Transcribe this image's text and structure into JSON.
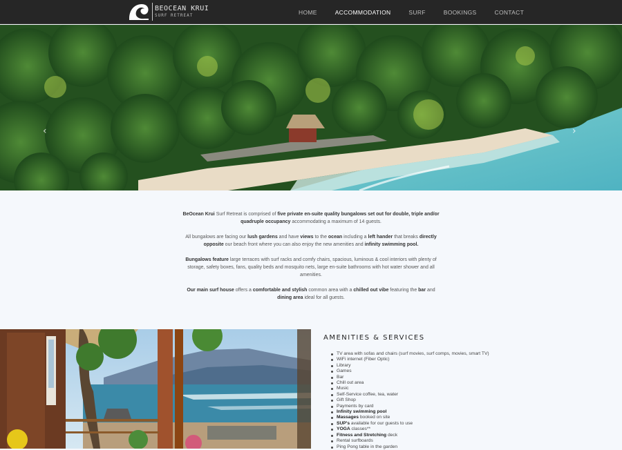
{
  "brand": {
    "name": "BEOCEAN KRUI",
    "tagline": "SURF RETREAT",
    "logo_icon": "wave-icon"
  },
  "nav": {
    "items": [
      {
        "label": "HOME",
        "active": false
      },
      {
        "label": "ACCOMMODATION",
        "active": true
      },
      {
        "label": "SURF",
        "active": false
      },
      {
        "label": "BOOKINGS",
        "active": false
      },
      {
        "label": "CONTACT",
        "active": false
      }
    ]
  },
  "carousel": {
    "prev_icon": "chevron-left-icon",
    "next_icon": "chevron-right-icon",
    "slide_count": 10,
    "active_index": 0,
    "prev_glyph": "‹",
    "next_glyph": "›"
  },
  "intro": {
    "paragraphs": [
      [
        {
          "t": "BeOcean Krui",
          "b": true
        },
        {
          "t": " Surf Retreat is comprised of ",
          "b": false
        },
        {
          "t": "five private en-suite quality bungalows set out for double, triple and/or quadruple occupancy",
          "b": true
        },
        {
          "t": " accommodating a maximum of 14 guests.",
          "b": false
        }
      ],
      [
        {
          "t": "All bungalows are facing our ",
          "b": false
        },
        {
          "t": "lush gardens",
          "b": true
        },
        {
          "t": " and have ",
          "b": false
        },
        {
          "t": "views",
          "b": true
        },
        {
          "t": " to the ",
          "b": false
        },
        {
          "t": "ocean",
          "b": true
        },
        {
          "t": " including a ",
          "b": false
        },
        {
          "t": "left hander",
          "b": true
        },
        {
          "t": " that breaks ",
          "b": false
        },
        {
          "t": "directly opposite",
          "b": true
        },
        {
          "t": " our beach front where you can also enjoy the new amenities and ",
          "b": false
        },
        {
          "t": "infinity swimming pool.",
          "b": true
        }
      ],
      [
        {
          "t": "Bungalows feature",
          "b": true
        },
        {
          "t": " large terraces with surf racks and comfy chairs, spacious, luminous & cool interiors with plenty of storage, safety boxes, fans, quality beds and mosquito nets, large en-suite bathrooms with hot water shower and all amenities.",
          "b": false
        }
      ],
      [
        {
          "t": "Our main surf house",
          "b": true
        },
        {
          "t": " offers a ",
          "b": false
        },
        {
          "t": "comfortable and stylish",
          "b": true
        },
        {
          "t": " common area with a ",
          "b": false
        },
        {
          "t": "chilled out vibe",
          "b": true
        },
        {
          "t": " featuring the ",
          "b": false
        },
        {
          "t": "bar",
          "b": true
        },
        {
          "t": " and ",
          "b": false
        },
        {
          "t": "dining area",
          "b": true
        },
        {
          "t": " ideal for all guests.",
          "b": false
        }
      ]
    ]
  },
  "amenities": {
    "title": "AMENITIES & SERVICES",
    "items": [
      [
        {
          "t": "TV area with sofas and chairs (surf movies, surf comps, movies, smart TV)",
          "b": false
        }
      ],
      [
        {
          "t": "WiFi internet (Fiber Optic)",
          "b": false
        }
      ],
      [
        {
          "t": "Library",
          "b": false
        }
      ],
      [
        {
          "t": "Games",
          "b": false
        }
      ],
      [
        {
          "t": "Bar",
          "b": false
        }
      ],
      [
        {
          "t": "Chill out area",
          "b": false
        }
      ],
      [
        {
          "t": "Music",
          "b": false
        }
      ],
      [
        {
          "t": "Self-Service coffee, tea, water",
          "b": false
        }
      ],
      [
        {
          "t": "Gift Shop",
          "b": false
        }
      ],
      [
        {
          "t": "Payments by card",
          "b": false
        }
      ],
      [
        {
          "t": "Infinity swimming pool",
          "b": true
        }
      ],
      [
        {
          "t": "Massages",
          "b": true
        },
        {
          "t": " booked on site",
          "b": false
        }
      ],
      [
        {
          "t": "SUP's",
          "b": true
        },
        {
          "t": " available for our guests to use",
          "b": false
        }
      ],
      [
        {
          "t": "YOGA",
          "b": true
        },
        {
          "t": " classes**",
          "b": false
        }
      ],
      [
        {
          "t": "Fitness and Stretching",
          "b": true
        },
        {
          "t": " deck",
          "b": false
        }
      ],
      [
        {
          "t": "Rental surfboards",
          "b": false
        }
      ],
      [
        {
          "t": "Ping Pong table in the garden",
          "b": false
        }
      ]
    ]
  },
  "colors": {
    "nav_bg": "#262626",
    "page_bg": "#f5f8fc",
    "text": "#555555",
    "heading": "#222222"
  }
}
